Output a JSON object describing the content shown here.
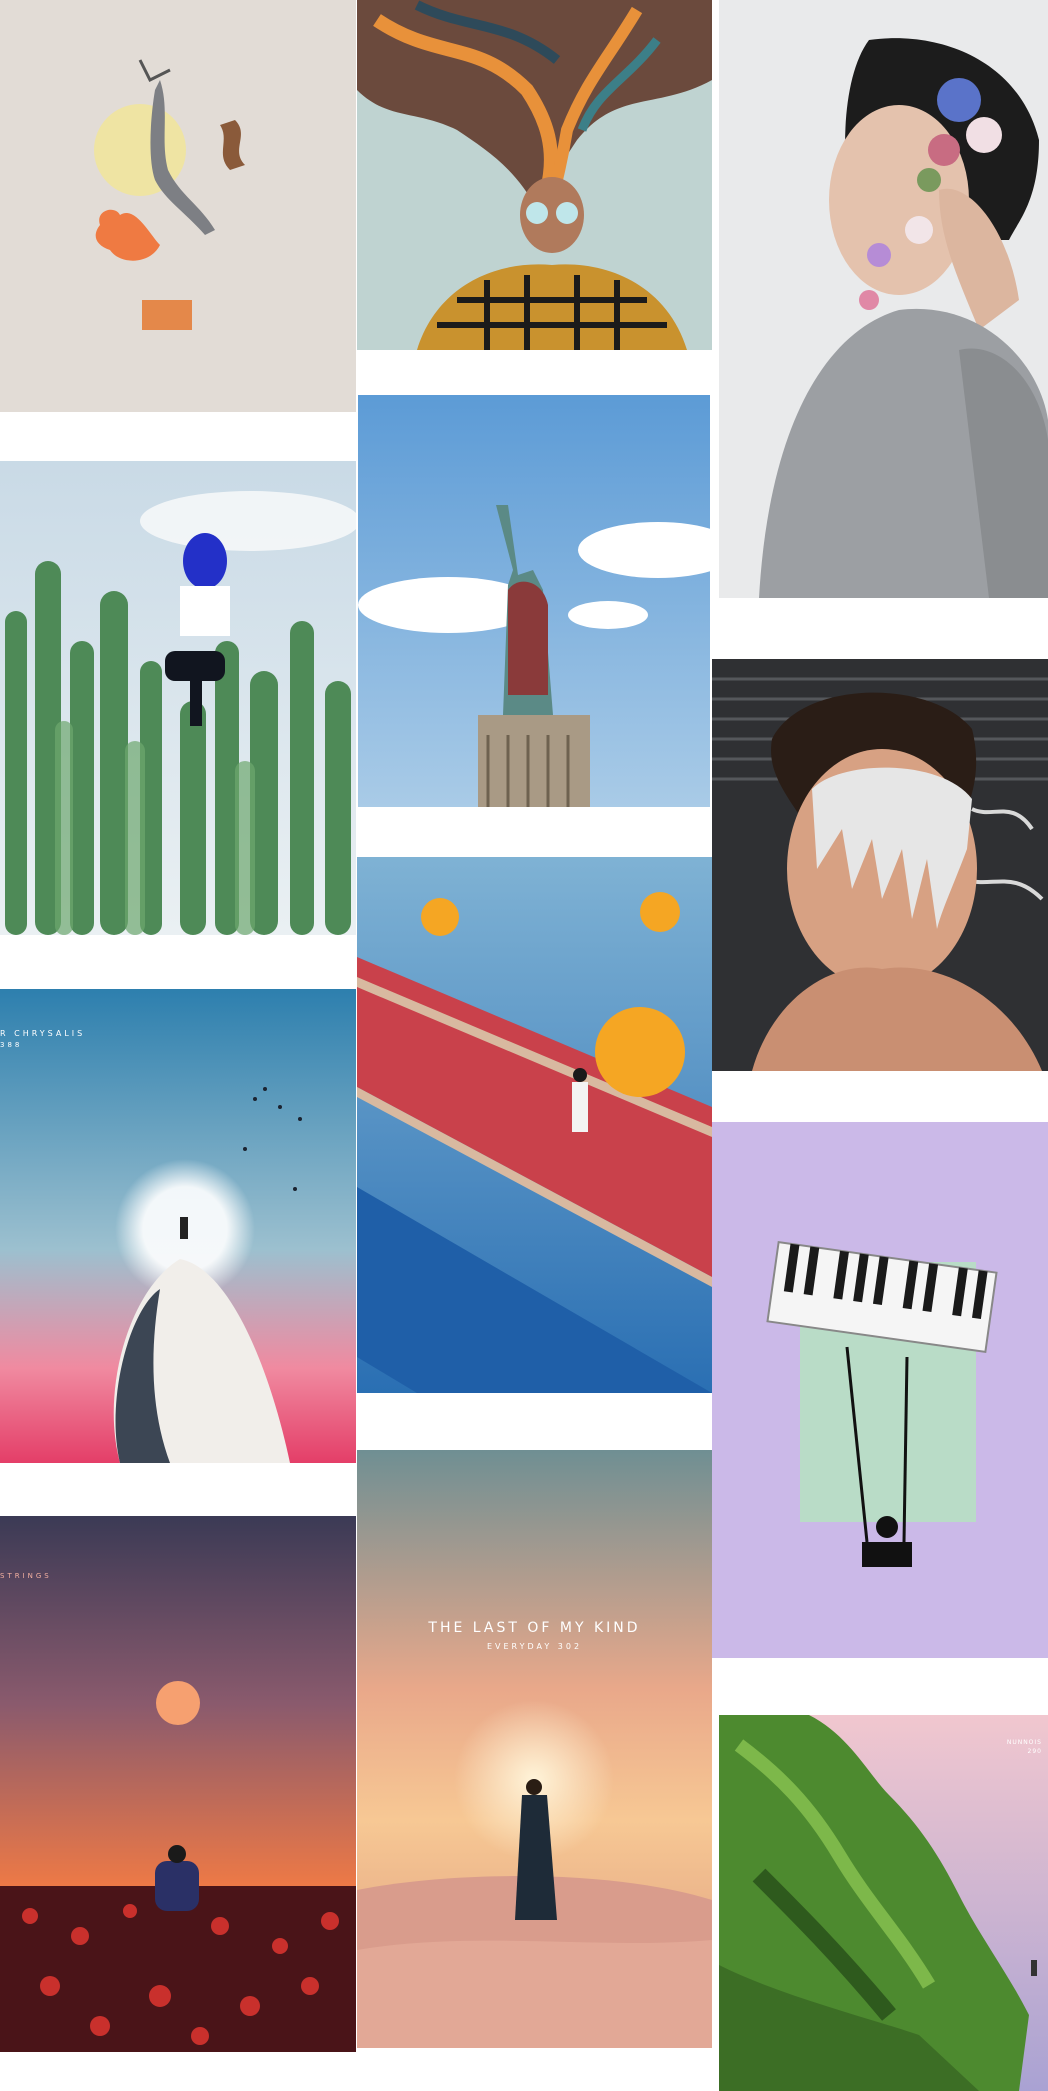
{
  "gallery": {
    "tiles": [
      {
        "name": "dancer-collage",
        "caption": ""
      },
      {
        "name": "flowing-hair-portrait",
        "caption": ""
      },
      {
        "name": "flower-face-portrait",
        "caption": ""
      },
      {
        "name": "cactus-balloon",
        "caption": ""
      },
      {
        "name": "statue-of-liberty",
        "caption": ""
      },
      {
        "name": "melting-face",
        "caption": ""
      },
      {
        "name": "chrysalis-ghost",
        "caption": "R CHRYSALIS",
        "subcaption": "388"
      },
      {
        "name": "red-carpet-orbs",
        "caption": ""
      },
      {
        "name": "piano-swing",
        "caption": ""
      },
      {
        "name": "strings-sunset",
        "caption": "STRINGS"
      },
      {
        "name": "last-of-my-kind",
        "caption": "THE LAST OF MY KIND",
        "subcaption": "EVERYDAY 302"
      },
      {
        "name": "cliff-island",
        "caption": "NUNNOIS",
        "subcaption": "290"
      }
    ]
  },
  "colors": {
    "background": "#ffffff",
    "lavender": "#cbb9e8",
    "sky": "#6fa5d8",
    "sunset": "#f07a45"
  }
}
